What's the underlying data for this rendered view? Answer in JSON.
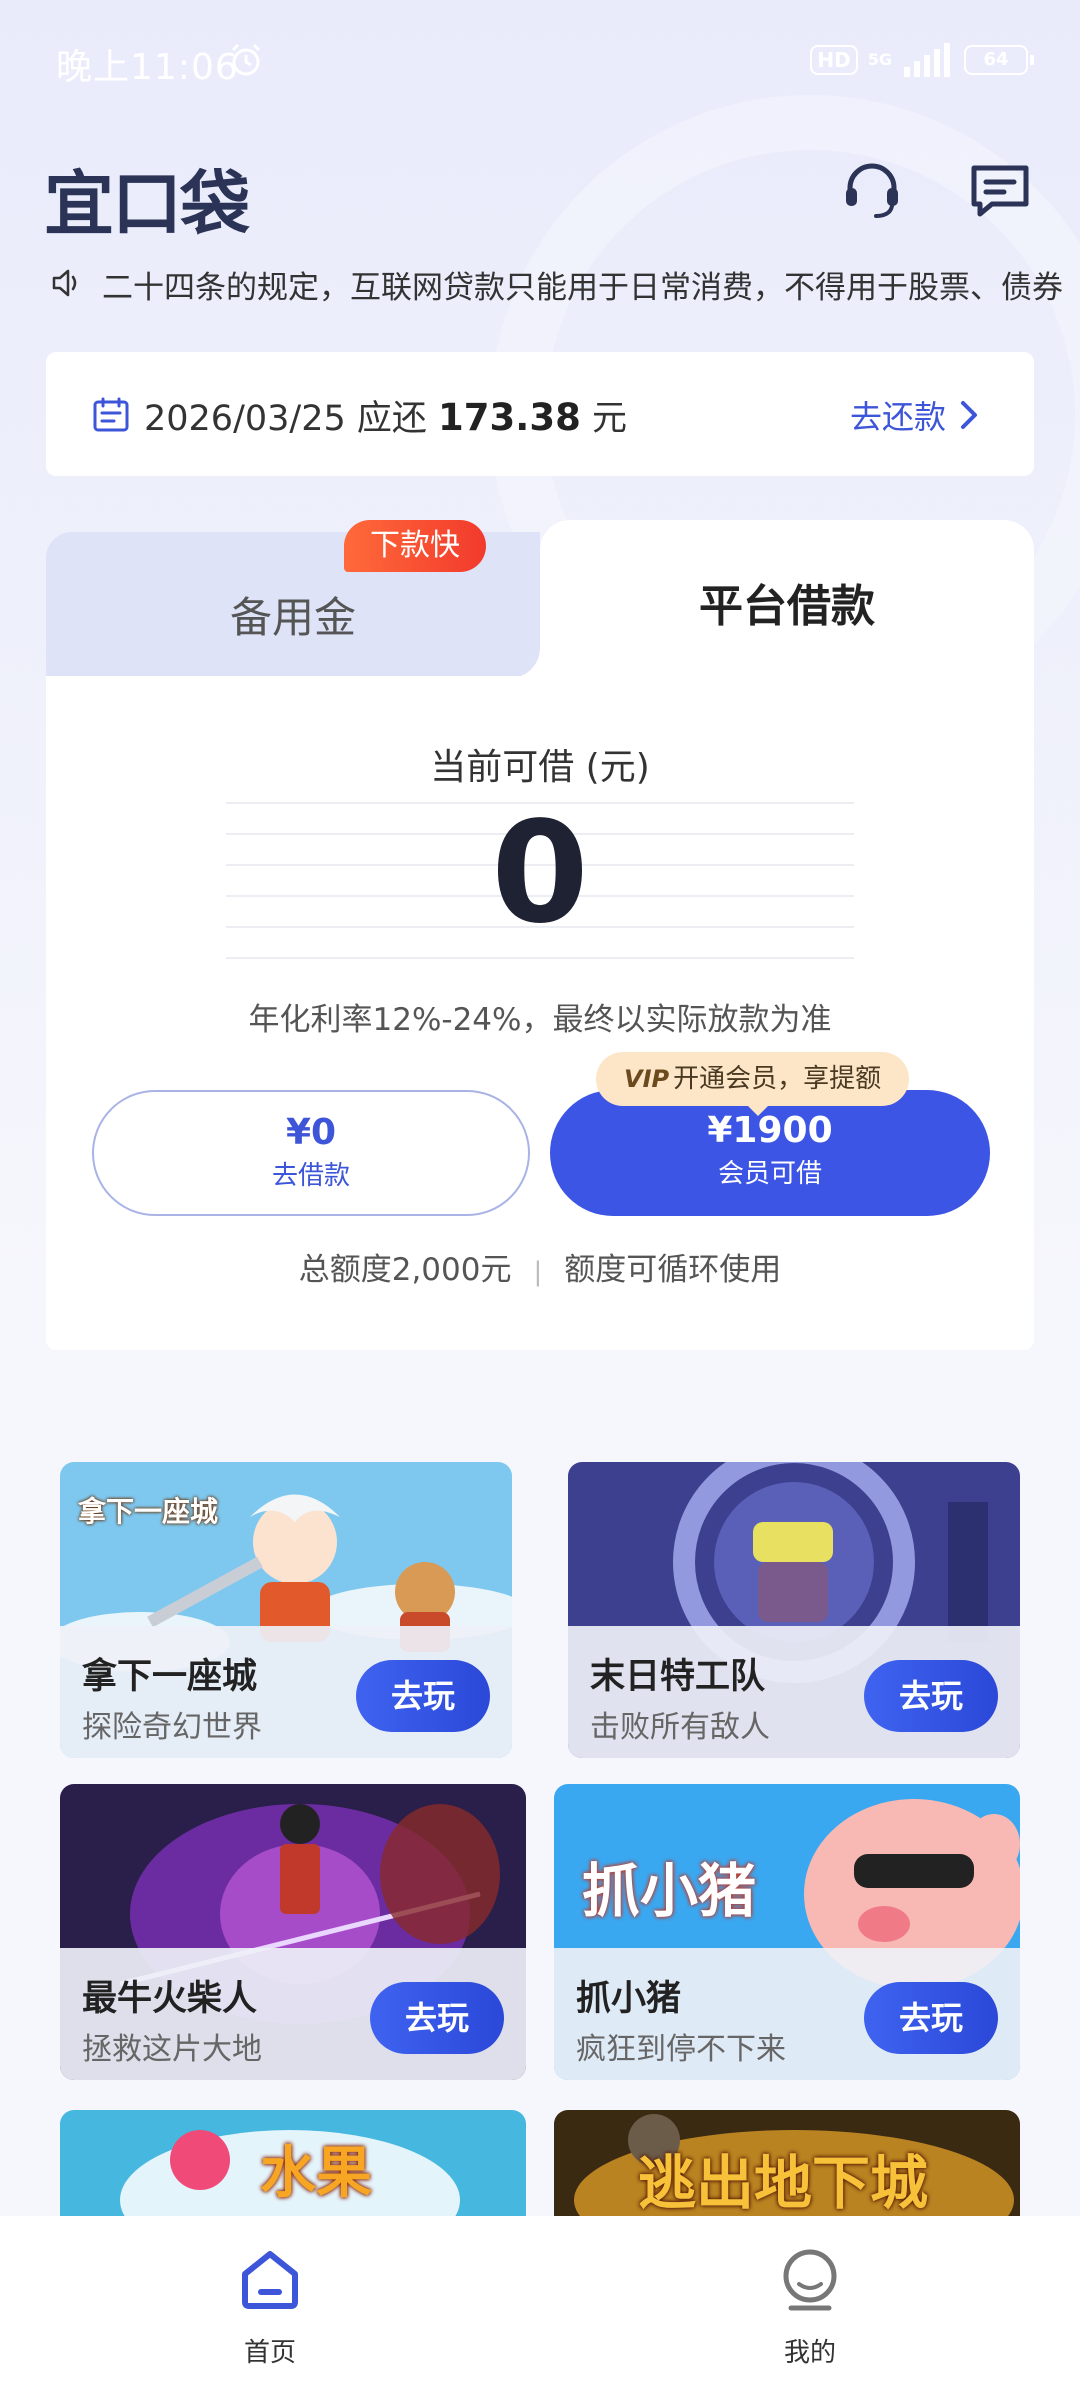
{
  "status_bar": {
    "time": "晚上11:06",
    "hd": "HD",
    "network": "5G",
    "battery": "64"
  },
  "header": {
    "logo": "宜口袋",
    "icons": [
      "headset-icon",
      "message-icon"
    ]
  },
  "notice": {
    "text": "二十四条的规定，互联网贷款只能用于日常消费，不得用于股票、债券"
  },
  "repayment": {
    "date": "2026/03/25",
    "due_label": "应还",
    "amount": "173.38",
    "unit": "元",
    "link": "去还款"
  },
  "loan": {
    "tabs": [
      {
        "label": "备用金",
        "badge": "下款快"
      },
      {
        "label": "平台借款"
      }
    ],
    "available_label": "当前可借 (元)",
    "available_amount": "0",
    "rate_note": "年化利率12%-24%，最终以实际放款为准",
    "borrow_button": {
      "amount": "¥0",
      "label": "去借款"
    },
    "member_button": {
      "amount": "¥1900",
      "label": "会员可借"
    },
    "vip_tip": {
      "badge": "VIP",
      "text": "开通会员，享提额"
    },
    "total_quota": "总额度2,000元",
    "quota_divider": "|",
    "recurring_note": "额度可循环使用"
  },
  "games": [
    {
      "title": "拿下一座城",
      "subtitle": "探险奇幻世界",
      "button": "去玩",
      "art_label": "拿下一座城"
    },
    {
      "title": "末日特工队",
      "subtitle": "击败所有敌人",
      "button": "去玩"
    },
    {
      "title": "最牛火柴人",
      "subtitle": "拯救这片大地",
      "button": "去玩"
    },
    {
      "title": "抓小猪",
      "subtitle": "疯狂到停不下来",
      "button": "去玩",
      "art_label": "抓小猪"
    },
    {
      "art_label": "水果"
    },
    {
      "art_label": "逃出地下城"
    }
  ],
  "bottom_nav": [
    {
      "label": "首页",
      "icon": "home-icon",
      "active": true
    },
    {
      "label": "我的",
      "icon": "profile-icon",
      "active": false
    }
  ],
  "colors": {
    "primary": "#3d55e5",
    "link": "#3d55d8",
    "badge": "#f23a2c",
    "vip_tip_bg": "#fde6c8"
  }
}
